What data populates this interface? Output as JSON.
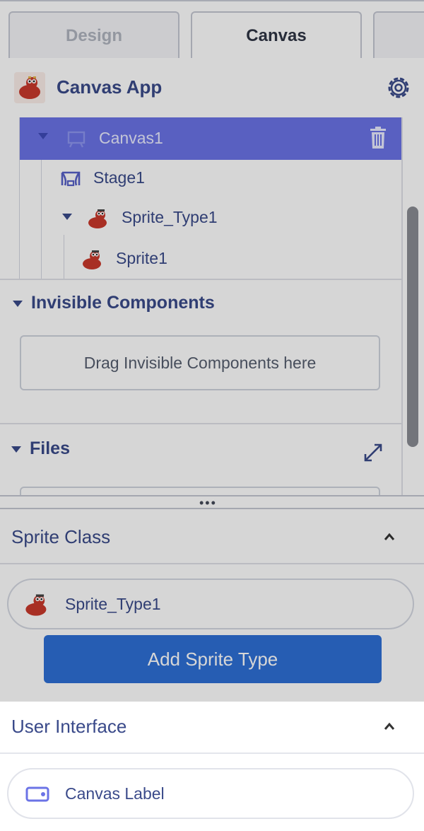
{
  "tabs": [
    {
      "label": "Design"
    },
    {
      "label": "Canvas"
    }
  ],
  "project": {
    "title": "Canvas App",
    "tree": {
      "canvas": "Canvas1",
      "stage": "Stage1",
      "sprite_type": "Sprite_Type1",
      "sprite": "Sprite1"
    }
  },
  "invisible_components": {
    "title": "Invisible Components",
    "drop_hint": "Drag Invisible Components here"
  },
  "files": {
    "title": "Files"
  },
  "splitter": {
    "dots": "•••"
  },
  "sprite_class": {
    "title": "Sprite Class",
    "item": "Sprite_Type1",
    "add_button": "Add Sprite Type"
  },
  "user_interface": {
    "title": "User Interface",
    "item": "Canvas Label"
  },
  "colors": {
    "accent": "#6b73e6",
    "primary_button": "#2e6fd6",
    "text": "#3a4a8a",
    "sprite_red": "#c9392c"
  },
  "icons": [
    "settings-gear-icon",
    "canvas-icon",
    "trash-icon",
    "stage-icon",
    "sprite-icon",
    "expand-icon",
    "chevron-up-icon",
    "label-icon"
  ]
}
